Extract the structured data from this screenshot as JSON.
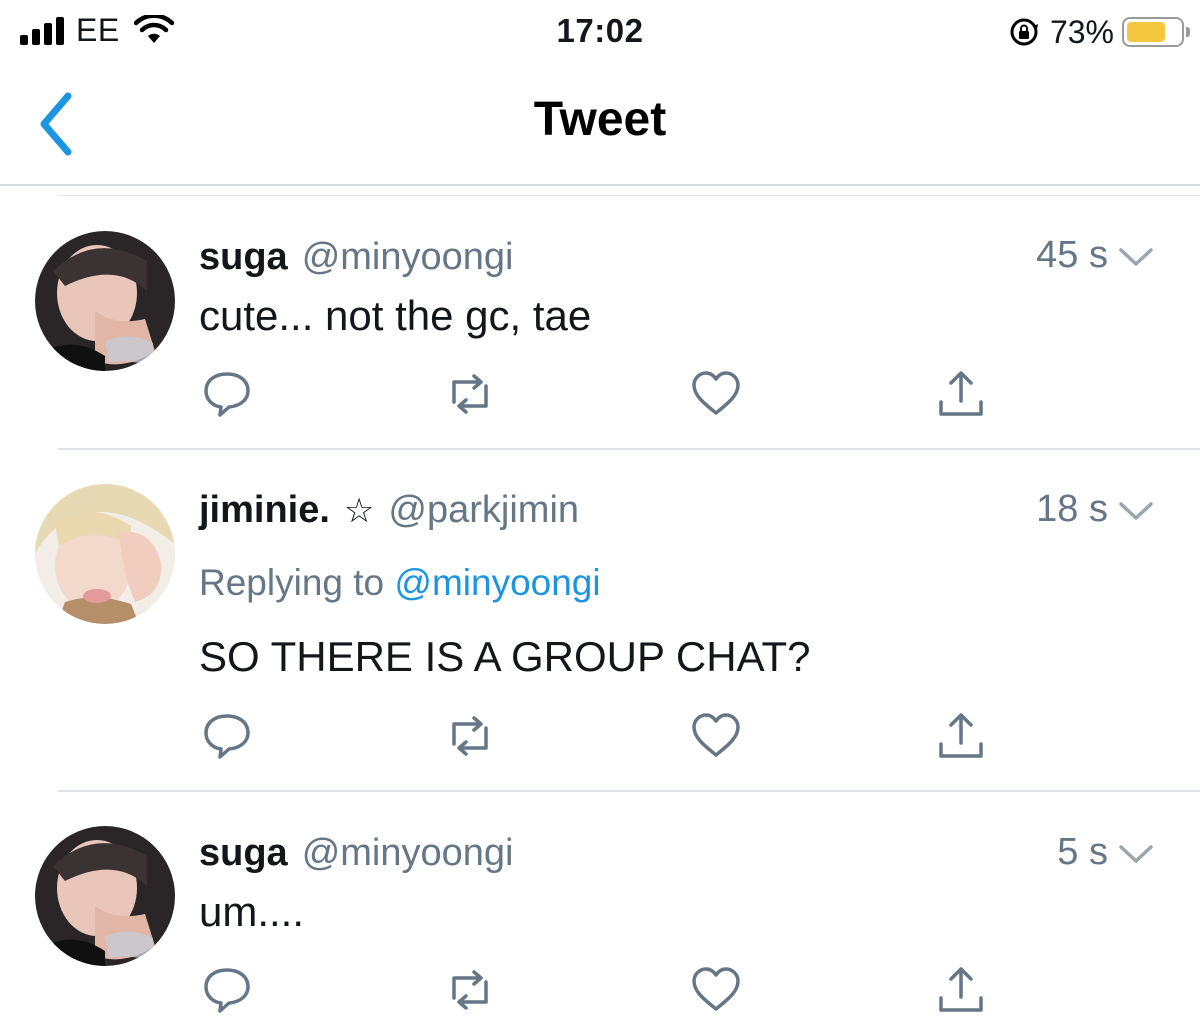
{
  "status_bar": {
    "carrier": "EE",
    "time": "17:02",
    "battery_percent": "73%",
    "battery_level": 0.73,
    "icons": [
      "signal-bars-icon",
      "wifi-icon",
      "orientation-lock-icon",
      "battery-icon"
    ]
  },
  "nav": {
    "title": "Tweet",
    "back_icon": "chevron-left-icon"
  },
  "tweets": [
    {
      "name": "suga",
      "handle": "@minyoongi",
      "time": "45 s",
      "text": "cute... not the gc, tae"
    },
    {
      "name": "jiminie.",
      "badge": "☆",
      "handle": "@parkjimin",
      "time": "18 s",
      "replying_prefix": "Replying to",
      "replying_to": "@minyoongi",
      "text": "SO THERE IS A GROUP CHAT?"
    },
    {
      "name": "suga",
      "handle": "@minyoongi",
      "time": "5 s",
      "text": "um...."
    }
  ],
  "action_icons": [
    "reply-icon",
    "retweet-icon",
    "like-icon",
    "share-icon"
  ],
  "colors": {
    "accent": "#1b95e0",
    "secondary_text": "#657786",
    "battery": "#f5c840"
  }
}
